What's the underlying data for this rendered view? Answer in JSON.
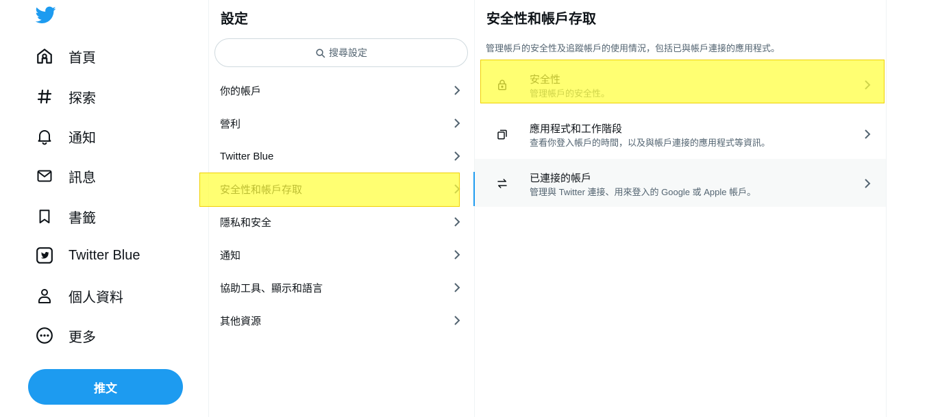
{
  "nav": {
    "logo": "twitter-bird-icon",
    "items": [
      {
        "label": "首頁",
        "icon": "home-icon"
      },
      {
        "label": "探索",
        "icon": "hashtag-icon"
      },
      {
        "label": "通知",
        "icon": "bell-icon"
      },
      {
        "label": "訊息",
        "icon": "envelope-icon"
      },
      {
        "label": "書籤",
        "icon": "bookmark-icon"
      },
      {
        "label": "Twitter Blue",
        "icon": "twitter-blue-icon"
      },
      {
        "label": "個人資料",
        "icon": "person-icon"
      },
      {
        "label": "更多",
        "icon": "more-circle-icon"
      }
    ],
    "tweet_button": "推文",
    "accent_color": "#1d9bf0"
  },
  "settings": {
    "title": "設定",
    "search_placeholder": "搜尋設定",
    "items": [
      {
        "label": "你的帳戶"
      },
      {
        "label": "營利"
      },
      {
        "label": "Twitter Blue"
      },
      {
        "label": "安全性和帳戶存取"
      },
      {
        "label": "隱私和安全"
      },
      {
        "label": "通知"
      },
      {
        "label": "協助工具、顯示和語言"
      },
      {
        "label": "其他資源"
      }
    ]
  },
  "detail": {
    "title": "安全性和帳戶存取",
    "description": "管理帳戶的安全性及追蹤帳戶的使用情況，包括已與帳戶連接的應用程式。",
    "items": [
      {
        "title": "安全性",
        "subtitle": "管理帳戶的安全性。",
        "icon": "lock-icon"
      },
      {
        "title": "應用程式和工作階段",
        "subtitle": "查看你登入帳戶的時間，以及與帳戶連接的應用程式等資訊。",
        "icon": "copy-windows-icon"
      },
      {
        "title": "已連接的帳戶",
        "subtitle": "管理與 Twitter 連接、用來登入的 Google 或 Apple 帳戶。",
        "icon": "arrows-swap-icon"
      }
    ]
  },
  "highlight_color": "#ffff3c"
}
